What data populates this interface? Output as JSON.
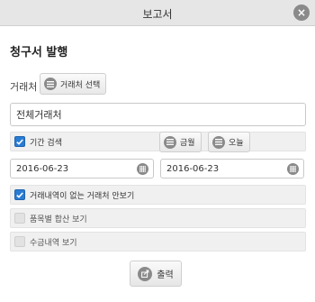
{
  "window": {
    "title": "보고서"
  },
  "heading": "청구서 발행",
  "client": {
    "label": "거래처",
    "select_button": "거래처 선택",
    "value": "전체거래처"
  },
  "period": {
    "checkbox_label": "기간 검색",
    "checked": true,
    "this_month_button": "금월",
    "today_button": "오늘",
    "start_date": "2016-06-23",
    "end_date": "2016-06-23"
  },
  "options": [
    {
      "label": "거래내역이 없는 거래처 안보기",
      "checked": true
    },
    {
      "label": "품목별 합산 보기",
      "checked": false
    },
    {
      "label": "수금내역 보기",
      "checked": false
    }
  ],
  "print_button": "출력",
  "icons": {
    "close": "close-icon",
    "list": "list-icon",
    "calendar": "calendar-icon",
    "print": "share-icon"
  },
  "colors": {
    "checkbox_accent": "#2a7cd3",
    "titlebar": "#e6e6e6",
    "row_bg": "#f0f0f0"
  }
}
